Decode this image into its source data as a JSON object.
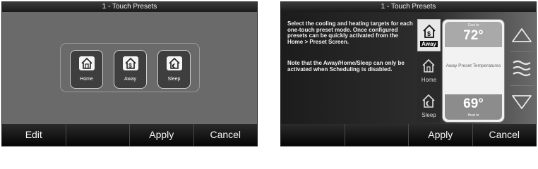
{
  "screen1": {
    "title": "1 - Touch Presets",
    "presets": [
      {
        "label": "Home",
        "icon": "house-icon"
      },
      {
        "label": "Away",
        "icon": "house-dollar-icon"
      },
      {
        "label": "Sleep",
        "icon": "house-moon-icon"
      }
    ],
    "footer": {
      "edit": "Edit",
      "blank": "",
      "apply": "Apply",
      "cancel": "Cancel"
    }
  },
  "screen2": {
    "title": "1 - Touch Presets",
    "description1": "Select the cooling and heating targets for each one-touch preset mode. Once configured presets can be quickly activated from the Home > Preset Screen.",
    "description2": "Note that the Away/Home/Sleep can only be activated when Scheduling is disabled.",
    "modes": [
      {
        "label": "Away",
        "icon": "house-dollar-icon",
        "selected": true
      },
      {
        "label": "Home",
        "icon": "house-icon",
        "selected": false
      },
      {
        "label": "Sleep",
        "icon": "house-moon-icon",
        "selected": false
      }
    ],
    "cool": {
      "label": "Cool to",
      "value": "72°"
    },
    "preset_text": "Away Preset Temperatures",
    "heat": {
      "label": "Heat to",
      "value": "69°"
    },
    "controls": [
      "up-arrow-icon",
      "fan-waves-icon",
      "down-arrow-icon"
    ],
    "footer": {
      "blank": "",
      "apply": "Apply",
      "cancel": "Cancel"
    }
  },
  "colors": {
    "title_bar": "#1f1f1f",
    "screen_gray": "#6a6a6a",
    "footer": "#0a0a0a"
  }
}
